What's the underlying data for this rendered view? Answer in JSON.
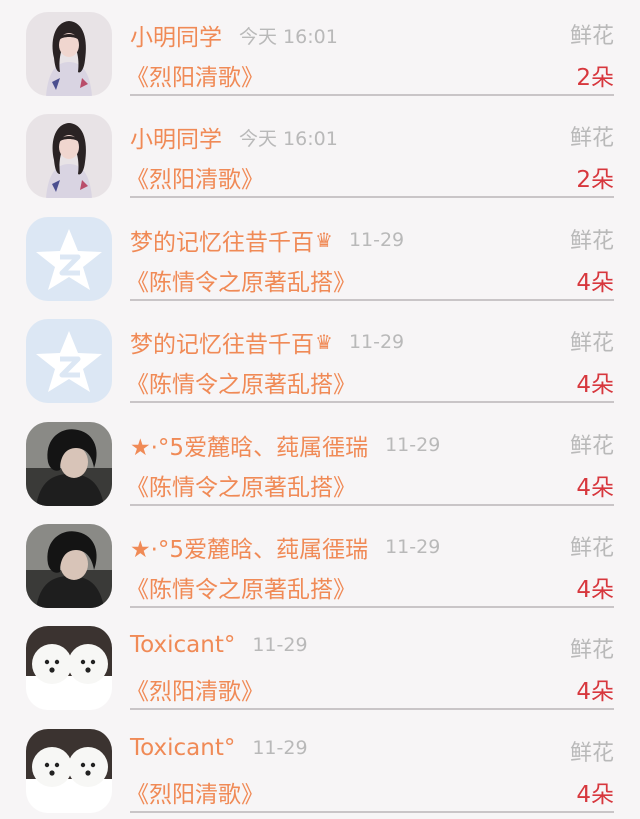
{
  "colors": {
    "name": "#f08a56",
    "title": "#f08a56",
    "count": "#d7373d",
    "muted": "#b9b9b9",
    "divider": "#c9c5c7",
    "background": "#f7f5f6"
  },
  "rows": [
    {
      "avatar": "girl-photo",
      "name": "小明同学",
      "crown": "",
      "time": "今天 16:01",
      "gift": "鲜花",
      "title": "《烈阳清歌》",
      "count": "2朵"
    },
    {
      "avatar": "girl-photo",
      "name": "小明同学",
      "crown": "",
      "time": "今天 16:01",
      "gift": "鲜花",
      "title": "《烈阳清歌》",
      "count": "2朵"
    },
    {
      "avatar": "star-logo",
      "name": "梦的记忆往昔千百",
      "crown": "♛",
      "time": "11-29",
      "gift": "鲜花",
      "title": "《陈情令之原著乱搭》",
      "count": "4朵"
    },
    {
      "avatar": "star-logo",
      "name": "梦的记忆往昔千百",
      "crown": "♛",
      "time": "11-29",
      "gift": "鲜花",
      "title": "《陈情令之原著乱搭》",
      "count": "4朵"
    },
    {
      "avatar": "dark-hair-photo",
      "name": "★·°5爱麓晗、莼属徰瑞",
      "crown": "",
      "time": "11-29",
      "gift": "鲜花",
      "title": "《陈情令之原著乱搭》",
      "count": "4朵"
    },
    {
      "avatar": "dark-hair-photo",
      "name": "★·°5爱麓晗、莼属徰瑞",
      "crown": "",
      "time": "11-29",
      "gift": "鲜花",
      "title": "《陈情令之原著乱搭》",
      "count": "4朵"
    },
    {
      "avatar": "white-dogs-photo",
      "name": "Toxicant°",
      "crown": "",
      "time": "11-29",
      "gift": "鲜花",
      "title": "《烈阳清歌》",
      "count": "4朵"
    },
    {
      "avatar": "white-dogs-photo",
      "name": "Toxicant°",
      "crown": "",
      "time": "11-29",
      "gift": "鲜花",
      "title": "《烈阳清歌》",
      "count": "4朵"
    }
  ]
}
